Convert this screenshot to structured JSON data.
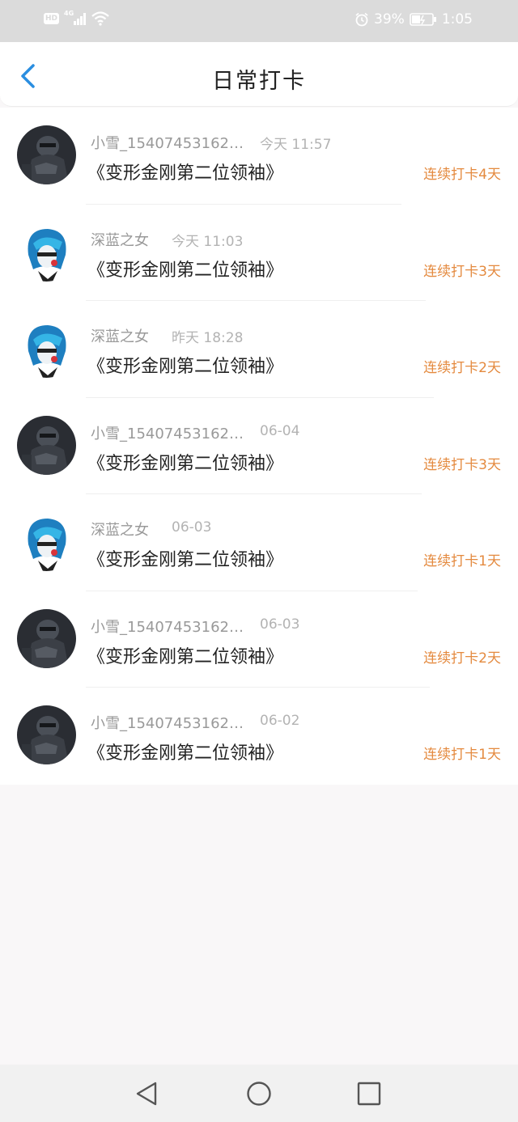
{
  "status": {
    "network": "4G",
    "hd": "HD",
    "battery": "39%",
    "time": "1:05"
  },
  "header": {
    "title": "日常打卡"
  },
  "rows": [
    {
      "user": "小雪_15407453162…",
      "time": "今天 11:57",
      "book": "《变形金刚第二位领袖》",
      "streak": "连续打卡4天",
      "avatar": "robot"
    },
    {
      "user": "深蓝之女",
      "time": "今天 11:03",
      "book": "《变形金刚第二位领袖》",
      "streak": "连续打卡3天",
      "avatar": "girl"
    },
    {
      "user": "深蓝之女",
      "time": "昨天 18:28",
      "book": "《变形金刚第二位领袖》",
      "streak": "连续打卡2天",
      "avatar": "girl"
    },
    {
      "user": "小雪_15407453162…",
      "time": "06-04",
      "book": "《变形金刚第二位领袖》",
      "streak": "连续打卡3天",
      "avatar": "robot"
    },
    {
      "user": "深蓝之女",
      "time": "06-03",
      "book": "《变形金刚第二位领袖》",
      "streak": "连续打卡1天",
      "avatar": "girl"
    },
    {
      "user": "小雪_15407453162…",
      "time": "06-03",
      "book": "《变形金刚第二位领袖》",
      "streak": "连续打卡2天",
      "avatar": "robot"
    },
    {
      "user": "小雪_15407453162…",
      "time": "06-02",
      "book": "《变形金刚第二位领袖》",
      "streak": "连续打卡1天",
      "avatar": "robot"
    }
  ],
  "colors": {
    "accent": "#e48a3f",
    "back": "#2a8ee0"
  }
}
